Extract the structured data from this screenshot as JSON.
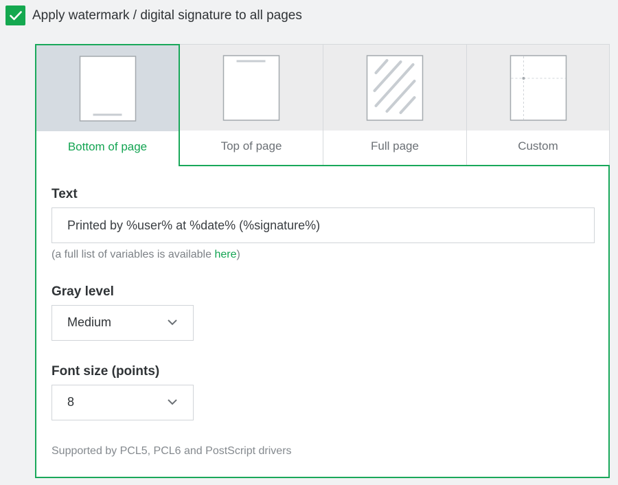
{
  "apply": {
    "checked": true,
    "label": "Apply watermark / digital signature to all pages"
  },
  "tabs": [
    {
      "label": "Bottom of page",
      "icon": "page-bottom-icon",
      "active": true
    },
    {
      "label": "Top of page",
      "icon": "page-top-icon",
      "active": false
    },
    {
      "label": "Full page",
      "icon": "page-full-icon",
      "active": false
    },
    {
      "label": "Custom",
      "icon": "page-custom-icon",
      "active": false
    }
  ],
  "text_field": {
    "label": "Text",
    "value": "Printed by %user% at %date% (%signature%)"
  },
  "hint": {
    "before": "(a full list of variables is available ",
    "link": "here",
    "after": ")"
  },
  "gray_level": {
    "label": "Gray level",
    "value": "Medium"
  },
  "font_size": {
    "label": "Font size (points)",
    "value": "8"
  },
  "footnote": "Supported by PCL5, PCL6 and PostScript drivers",
  "colors": {
    "accent": "#19a85a",
    "background": "#f1f2f3"
  }
}
